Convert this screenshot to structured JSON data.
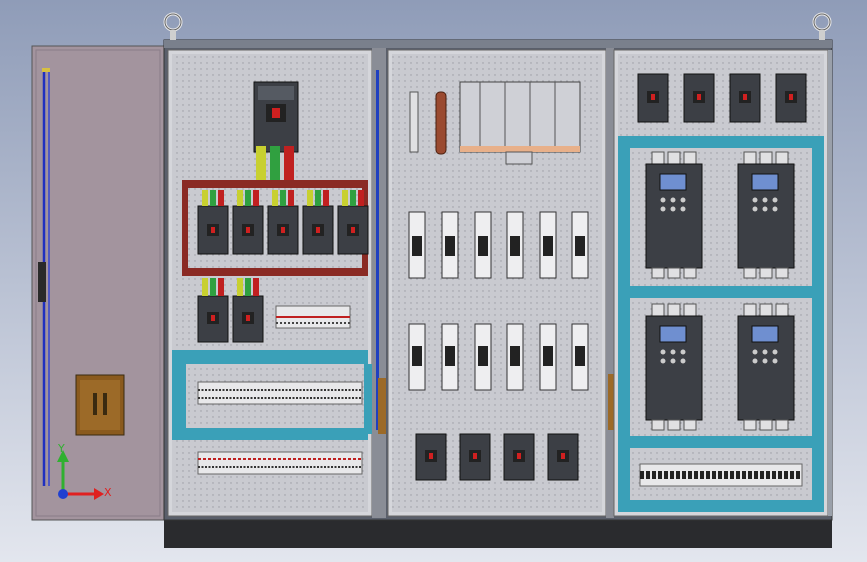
{
  "viewport": {
    "background_top": "#8f9cb8",
    "background_bottom": "#dfe3ec"
  },
  "colors": {
    "cabinet_frame": "#5a5f6b",
    "panel": "#c9cad0",
    "door": "#a3949e",
    "cable_tray": "#3aa0b8",
    "busbar": "#8a2a24",
    "device_dark": "#3c3f45",
    "inverter_screen": "#6f8fd0",
    "base": "#2a2b2e"
  },
  "triad": {
    "x_label": "X",
    "y_label": "Y",
    "x_color": "#e02020",
    "y_color": "#30b030",
    "z_color": "#2040d0"
  },
  "components": {
    "top_breakers_count": 4,
    "main_breaker_count": 1,
    "branch_breakers_row1": 5,
    "branch_breakers_row2": 2,
    "fuse_holders_row1": 6,
    "fuse_holders_row2": 6,
    "bottom_breakers_center": 4,
    "inverters": 4,
    "lifting_eyes": 2
  }
}
